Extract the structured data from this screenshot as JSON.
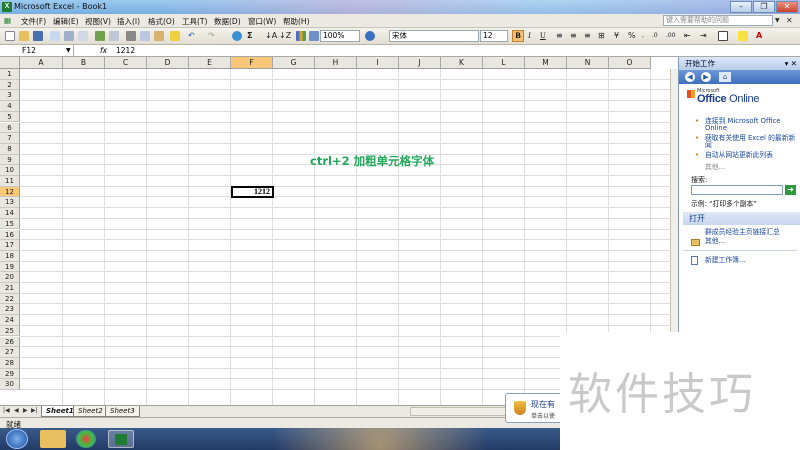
{
  "window": {
    "title": "Microsoft Excel - Book1"
  },
  "menu": {
    "items": [
      "文件(F)",
      "编辑(E)",
      "视图(V)",
      "插入(I)",
      "格式(O)",
      "工具(T)",
      "数据(D)",
      "窗口(W)",
      "帮助(H)"
    ],
    "help_placeholder": "键入需要帮助的问题"
  },
  "toolbar": {
    "zoom": "100%",
    "font": "宋体",
    "font_size": "12",
    "bold": "B",
    "italic": "I",
    "underline": "U"
  },
  "formula_bar": {
    "name_box": "F12",
    "fx": "fx",
    "value": "1212"
  },
  "grid": {
    "columns": [
      "A",
      "B",
      "C",
      "D",
      "E",
      "F",
      "G",
      "H",
      "I",
      "J",
      "K",
      "L",
      "M",
      "N",
      "O"
    ],
    "rows": [
      "1",
      "2",
      "3",
      "4",
      "5",
      "6",
      "7",
      "8",
      "9",
      "10",
      "11",
      "12",
      "13",
      "14",
      "15",
      "16",
      "17",
      "18",
      "19",
      "20",
      "21",
      "22",
      "23",
      "24",
      "25",
      "26",
      "27",
      "28",
      "29",
      "30"
    ],
    "selected_column": "F",
    "selected_row": "12",
    "active_cell_value": "1212"
  },
  "annotation": {
    "text": "ctrl+2   加粗单元格字体",
    "color": "#21a85a"
  },
  "task_pane": {
    "title": "开始工作",
    "logo_small": "Microsoft",
    "logo_main": "Office",
    "logo_online": "Online",
    "links": [
      "连接到 Microsoft Office Online",
      "获取有关使用 Excel 的最新新闻",
      "自动从网站更新此列表"
    ],
    "other": "其他...",
    "search_label": "搜索:",
    "example": "示例:  “打印多个副本”",
    "open_section": "打开",
    "open_items": [
      "群成员经验主页链接汇总",
      "其他..."
    ],
    "new_workbook": "新建工作簿..."
  },
  "sheets": {
    "tabs": [
      "Sheet1",
      "Sheet2",
      "Sheet3"
    ],
    "active": "Sheet1"
  },
  "status": {
    "text": "就绪"
  },
  "notification": {
    "title": "现在有",
    "subtitle": "单击以使"
  },
  "watermark": {
    "text": "软件技巧"
  }
}
